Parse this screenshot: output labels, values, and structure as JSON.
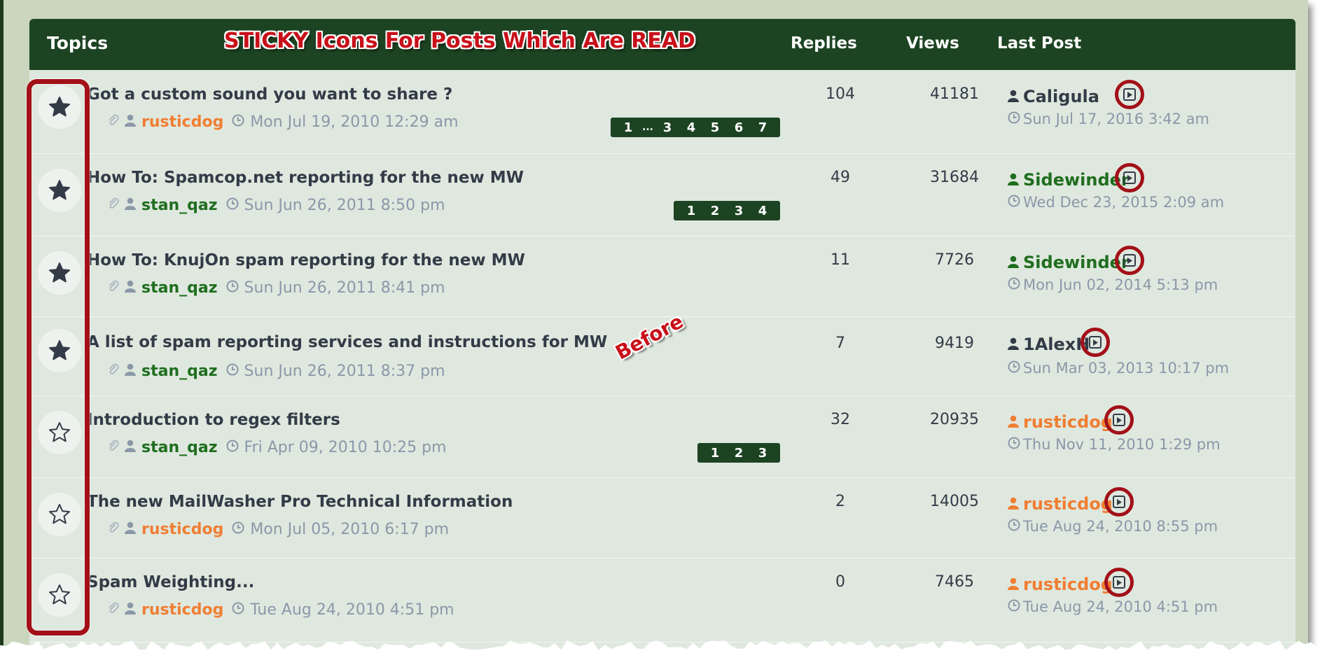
{
  "header": {
    "topics_label": "Topics",
    "replies_label": "Replies",
    "views_label": "Views",
    "last_post_label": "Last Post"
  },
  "annotations": {
    "banner": "STICKY Icons For Posts Which Are READ",
    "before": "Before"
  },
  "colors": {
    "header_bg": "#1c4322",
    "annotation_red": "#a31018",
    "author_orange": "#f07e33",
    "author_green": "#1f6e1f"
  },
  "topics": [
    {
      "icon": "star-filled-icon",
      "title": "Got a custom sound you want to share ?",
      "author": "rusticdog",
      "author_color": "orange",
      "date": "Mon Jul 19, 2010 12:29 am",
      "pages": [
        "1",
        "...",
        "3",
        "4",
        "5",
        "6",
        "7"
      ],
      "replies": "104",
      "views": "41181",
      "last_author": "Caligula",
      "last_author_color": "dark",
      "last_time": "Sun Jul 17, 2016 3:42 am"
    },
    {
      "icon": "star-filled-icon",
      "title": "How To: Spamcop.net reporting for the new MW",
      "author": "stan_qaz",
      "author_color": "green",
      "date": "Sun Jun 26, 2011 8:50 pm",
      "pages": [
        "1",
        "2",
        "3",
        "4"
      ],
      "replies": "49",
      "views": "31684",
      "last_author": "Sidewinder",
      "last_author_color": "green",
      "last_time": "Wed Dec 23, 2015 2:09 am"
    },
    {
      "icon": "star-filled-icon",
      "title": "How To: KnujOn spam reporting for the new MW",
      "author": "stan_qaz",
      "author_color": "green",
      "date": "Sun Jun 26, 2011 8:41 pm",
      "pages": [],
      "replies": "11",
      "views": "7726",
      "last_author": "Sidewinder",
      "last_author_color": "green",
      "last_time": "Mon Jun 02, 2014 5:13 pm"
    },
    {
      "icon": "star-filled-icon",
      "title": "A list of spam reporting services and instructions for MW",
      "author": "stan_qaz",
      "author_color": "green",
      "date": "Sun Jun 26, 2011 8:37 pm",
      "pages": [],
      "replies": "7",
      "views": "9419",
      "last_author": "1AlexH",
      "last_author_color": "dark",
      "last_time": "Sun Mar 03, 2013 10:17 pm"
    },
    {
      "icon": "star-outline-icon",
      "title": "Introduction to regex filters",
      "author": "stan_qaz",
      "author_color": "green",
      "date": "Fri Apr 09, 2010 10:25 pm",
      "pages": [
        "1",
        "2",
        "3"
      ],
      "replies": "32",
      "views": "20935",
      "last_author": "rusticdog",
      "last_author_color": "orange",
      "last_time": "Thu Nov 11, 2010 1:29 pm"
    },
    {
      "icon": "star-outline-icon",
      "title": "The new MailWasher Pro Technical Information",
      "author": "rusticdog",
      "author_color": "orange",
      "date": "Mon Jul 05, 2010 6:17 pm",
      "pages": [],
      "replies": "2",
      "views": "14005",
      "last_author": "rusticdog",
      "last_author_color": "orange",
      "last_time": "Tue Aug 24, 2010 8:55 pm"
    },
    {
      "icon": "star-outline-icon",
      "title": "Spam Weighting...",
      "author": "rusticdog",
      "author_color": "orange",
      "date": "Tue Aug 24, 2010 4:51 pm",
      "pages": [],
      "replies": "0",
      "views": "7465",
      "last_author": "rusticdog",
      "last_author_color": "orange",
      "last_time": "Tue Aug 24, 2010 4:51 pm"
    }
  ]
}
